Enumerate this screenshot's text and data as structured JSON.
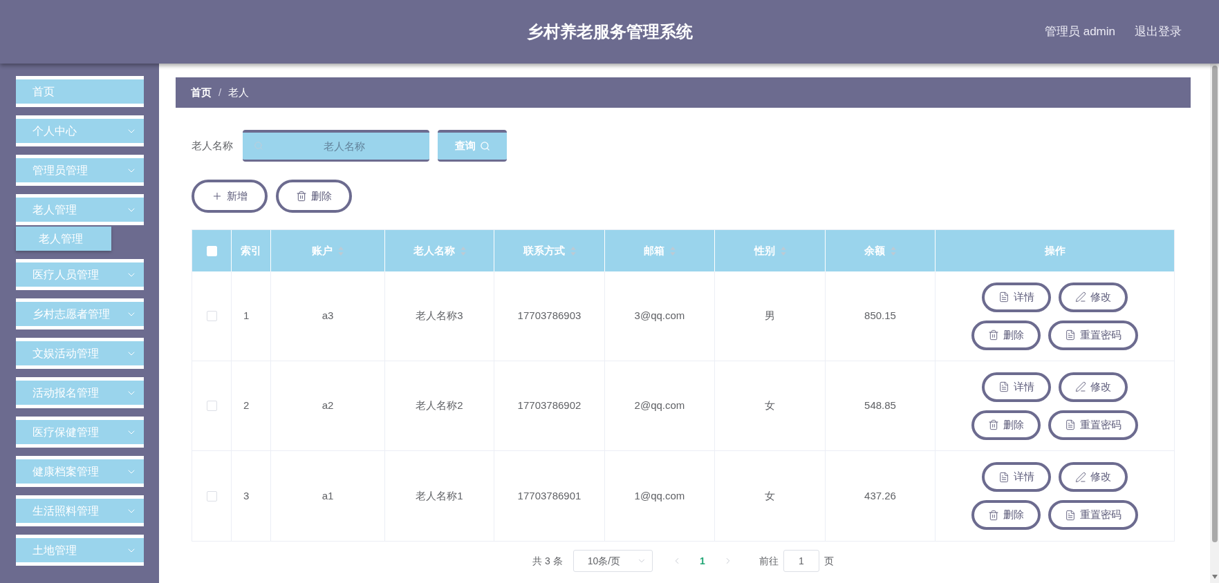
{
  "header": {
    "title": "乡村养老服务管理系统",
    "user": "管理员 admin",
    "logout": "退出登录"
  },
  "sidebar": {
    "items": [
      {
        "label": "首页",
        "kind": "link"
      },
      {
        "label": "个人中心",
        "kind": "submenu"
      },
      {
        "label": "管理员管理",
        "kind": "submenu"
      },
      {
        "label": "老人管理",
        "kind": "submenu",
        "children": [
          {
            "label": "老人管理"
          }
        ]
      },
      {
        "label": "医疗人员管理",
        "kind": "submenu"
      },
      {
        "label": "乡村志愿者管理",
        "kind": "submenu"
      },
      {
        "label": "文娱活动管理",
        "kind": "submenu"
      },
      {
        "label": "活动报名管理",
        "kind": "submenu"
      },
      {
        "label": "医疗保健管理",
        "kind": "submenu"
      },
      {
        "label": "健康档案管理",
        "kind": "submenu"
      },
      {
        "label": "生活照料管理",
        "kind": "submenu"
      },
      {
        "label": "土地管理",
        "kind": "submenu"
      }
    ]
  },
  "breadcrumb": {
    "items": [
      {
        "label": "首页",
        "kind": "link"
      },
      {
        "label": "老人",
        "kind": "current"
      }
    ],
    "separator": "/"
  },
  "search": {
    "label": "老人名称",
    "placeholder": "老人名称",
    "button": "查询"
  },
  "toolbar": [
    {
      "label": "新增",
      "kind": "add"
    },
    {
      "label": "删除",
      "kind": "delete"
    }
  ],
  "table": {
    "select_all": {
      "checked": false
    },
    "columns": [
      {
        "label": "索引",
        "sortable": false
      },
      {
        "label": "账户",
        "sortable": true
      },
      {
        "label": "老人名称",
        "sortable": true
      },
      {
        "label": "联系方式",
        "sortable": true
      },
      {
        "label": "邮箱",
        "sortable": true
      },
      {
        "label": "性别",
        "sortable": true
      },
      {
        "label": "余额",
        "sortable": true
      },
      {
        "label": "操作",
        "sortable": false
      }
    ],
    "rows": [
      {
        "checked": false,
        "cells": [
          "1",
          "a3",
          "老人名称3",
          "17703786903",
          "3@qq.com",
          "男",
          "850.15"
        ],
        "actions": [
          {
            "label": "详情",
            "kind": "detail"
          },
          {
            "label": "修改",
            "kind": "edit"
          },
          {
            "label": "删除",
            "kind": "delete"
          },
          {
            "label": "重置密码",
            "kind": "reset"
          }
        ]
      },
      {
        "checked": false,
        "cells": [
          "2",
          "a2",
          "老人名称2",
          "17703786902",
          "2@qq.com",
          "女",
          "548.85"
        ],
        "actions": [
          {
            "label": "详情",
            "kind": "detail"
          },
          {
            "label": "修改",
            "kind": "edit"
          },
          {
            "label": "删除",
            "kind": "delete"
          },
          {
            "label": "重置密码",
            "kind": "reset"
          }
        ]
      },
      {
        "checked": false,
        "cells": [
          "3",
          "a1",
          "老人名称1",
          "17703786901",
          "1@qq.com",
          "女",
          "437.26"
        ],
        "actions": [
          {
            "label": "详情",
            "kind": "detail"
          },
          {
            "label": "修改",
            "kind": "edit"
          },
          {
            "label": "删除",
            "kind": "delete"
          },
          {
            "label": "重置密码",
            "kind": "reset"
          }
        ]
      }
    ]
  },
  "pagination": {
    "total": "共 3 条",
    "page_size": "10条/页",
    "pages": [
      {
        "label": "1",
        "selected": true
      }
    ],
    "goto_label": "前往",
    "goto_value": "1",
    "goto_suffix": "页"
  }
}
